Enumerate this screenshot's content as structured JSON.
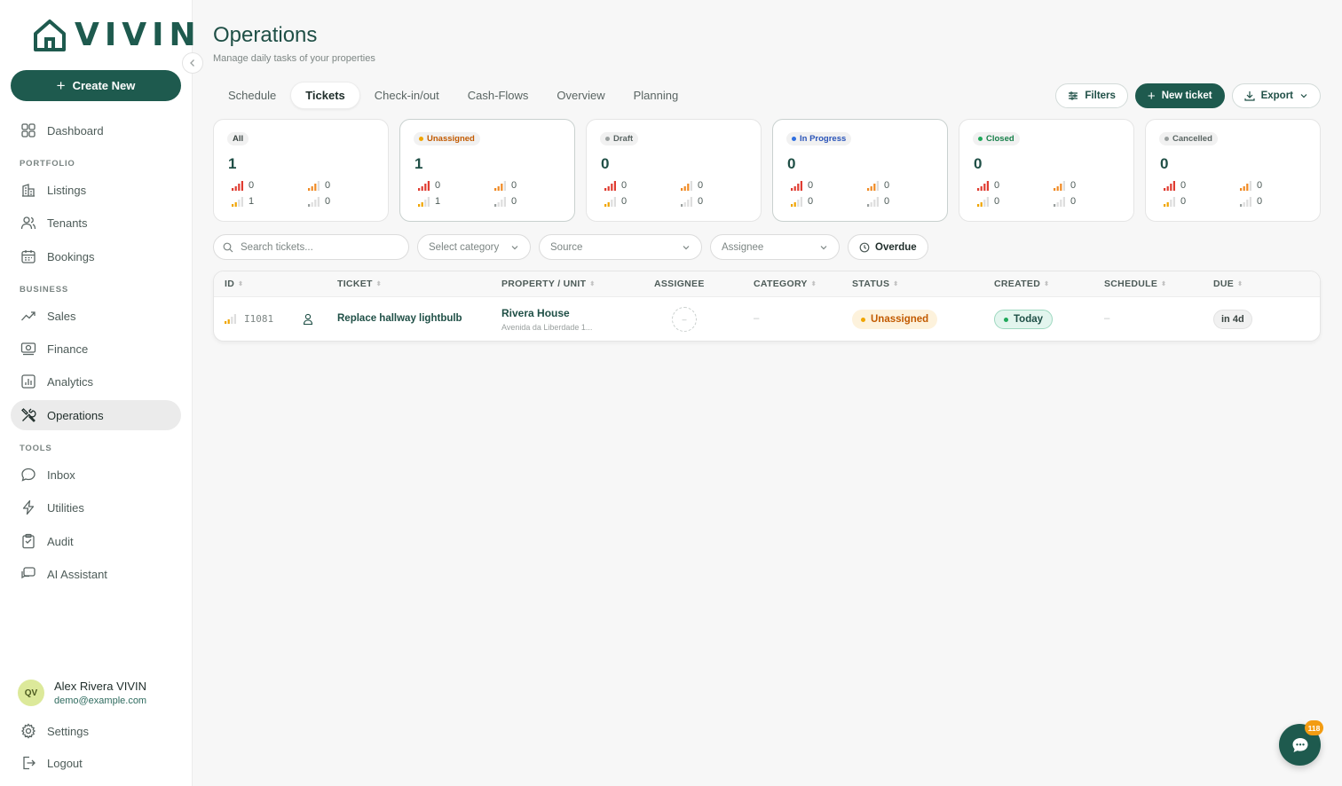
{
  "brand": {
    "name": "VIVIN",
    "accent": "#1e5a4e"
  },
  "sidebar": {
    "create_label": "Create New",
    "items": {
      "dashboard": "Dashboard",
      "listings": "Listings",
      "tenants": "Tenants",
      "bookings": "Bookings",
      "sales": "Sales",
      "finance": "Finance",
      "analytics": "Analytics",
      "operations": "Operations",
      "inbox": "Inbox",
      "utilities": "Utilities",
      "audit": "Audit",
      "ai_assistant": "AI Assistant",
      "settings": "Settings",
      "logout": "Logout"
    },
    "sections": {
      "portfolio": "PORTFOLIO",
      "business": "BUSINESS",
      "tools": "TOOLS"
    },
    "user": {
      "initials": "QV",
      "name": "Alex Rivera VIVIN",
      "email": "demo@example.com"
    }
  },
  "header": {
    "title": "Operations",
    "subtitle": "Manage daily tasks of your properties",
    "tabs": [
      "Schedule",
      "Tickets",
      "Check-in/out",
      "Cash-Flows",
      "Overview",
      "Planning"
    ],
    "active_tab": "Tickets",
    "actions": {
      "filters": "Filters",
      "new_ticket": "New ticket",
      "export": "Export"
    }
  },
  "status_cards": [
    {
      "label": "All",
      "count": "1",
      "dot": "",
      "text_color": "#3a4542",
      "prio": [
        "0",
        "0",
        "1",
        "0"
      ]
    },
    {
      "label": "Unassigned",
      "count": "1",
      "dot": "#f0a500",
      "text_color": "#c25a00",
      "prio": [
        "0",
        "0",
        "1",
        "0"
      ]
    },
    {
      "label": "Draft",
      "count": "0",
      "dot": "#9aa09f",
      "text_color": "#5a6563",
      "prio": [
        "0",
        "0",
        "0",
        "0"
      ]
    },
    {
      "label": "In Progress",
      "count": "0",
      "dot": "#2f6fe0",
      "text_color": "#2a54b8",
      "prio": [
        "0",
        "0",
        "0",
        "0"
      ]
    },
    {
      "label": "Closed",
      "count": "0",
      "dot": "#1fa85a",
      "text_color": "#17804a",
      "prio": [
        "0",
        "0",
        "0",
        "0"
      ]
    },
    {
      "label": "Cancelled",
      "count": "0",
      "dot": "#9aa09f",
      "text_color": "#5a6563",
      "prio": [
        "0",
        "0",
        "0",
        "0"
      ]
    }
  ],
  "filters": {
    "search_placeholder": "Search tickets...",
    "category": "Select category",
    "source": "Source",
    "assignee": "Assignee",
    "overdue": "Overdue"
  },
  "table": {
    "columns": [
      "ID",
      "TICKET",
      "PROPERTY / UNIT",
      "ASSIGNEE",
      "CATEGORY",
      "STATUS",
      "CREATED",
      "SCHEDULE",
      "DUE"
    ],
    "rows": [
      {
        "id": "I1081",
        "ticket": "Replace hallway lightbulb",
        "property": "Rivera House",
        "unit": "Avenida da Liberdade 1...",
        "assignee": "–",
        "category": "–",
        "status": "Unassigned",
        "created": "Today",
        "schedule": "–",
        "due": "in 4d"
      }
    ]
  },
  "chat": {
    "badge": "118"
  }
}
